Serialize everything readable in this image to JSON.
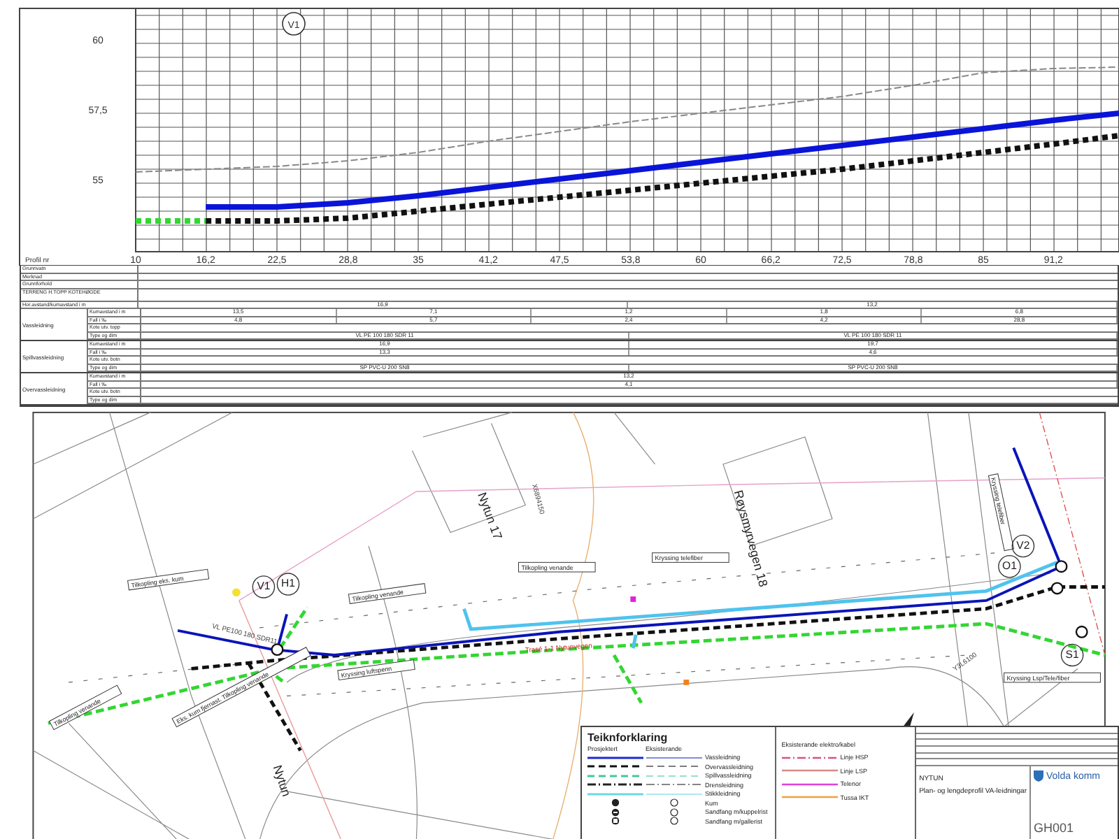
{
  "profile": {
    "row_label": "Profil nr",
    "marker": "V1",
    "chart_data": {
      "type": "line",
      "x": [
        10,
        16.2,
        22.5,
        28.8,
        35,
        41.2,
        47.5,
        53.8,
        60,
        66.2,
        72.5,
        78.8,
        85,
        91.2,
        97
      ],
      "series": [
        {
          "color": "#888888",
          "line_style": "dashed",
          "values": [
            55.4,
            55.5,
            55.6,
            55.8,
            56.1,
            56.5,
            56.85,
            57.2,
            57.5,
            57.8,
            58.1,
            58.5,
            58.95,
            59.1,
            59.15
          ]
        },
        {
          "color": "#0a14d8",
          "line_style": "solid",
          "values": [
            null,
            54.15,
            54.15,
            54.3,
            54.55,
            54.85,
            55.15,
            55.45,
            55.75,
            56.05,
            56.35,
            56.65,
            56.95,
            57.25,
            57.5
          ]
        },
        {
          "color": "#111111",
          "line_style": "dotted",
          "values": [
            null,
            53.65,
            53.65,
            53.75,
            54.0,
            54.25,
            54.5,
            54.75,
            55.0,
            55.25,
            55.5,
            55.8,
            56.1,
            56.4,
            56.7
          ]
        },
        {
          "color": "#33d633",
          "line_style": "dotted",
          "values": [
            53.65,
            53.65,
            null,
            null,
            null,
            null,
            null,
            null,
            null,
            null,
            null,
            null,
            null,
            null,
            null
          ]
        }
      ],
      "xlim": [
        10,
        97
      ],
      "grid": true,
      "xticks": [
        10,
        {
          "value": 16.2,
          "label": "16,2"
        },
        {
          "value": 22.5,
          "label": "22,5"
        },
        {
          "value": 28.8,
          "label": "28,8"
        },
        35,
        {
          "value": 41.2,
          "label": "41,2"
        },
        {
          "value": 47.5,
          "label": "47,5"
        },
        {
          "value": 53.8,
          "label": "53,8"
        },
        60,
        {
          "value": 66.2,
          "label": "66,2"
        },
        {
          "value": 72.5,
          "label": "72,5"
        },
        {
          "value": 78.8,
          "label": "78,8"
        },
        85,
        {
          "value": 91.2,
          "label": "91,2"
        }
      ],
      "yticks": [
        55,
        {
          "value": 57.5,
          "label": "57,5"
        },
        60
      ],
      "ylim": [
        52.55,
        61.25
      ]
    }
  },
  "table": {
    "rows": [
      {
        "label": "Grunnvatn"
      },
      {
        "label": "Merknad"
      },
      {
        "label": "Grunnforhold"
      },
      {
        "label": "TERRENG H.TOPP KOTEHØGDE"
      },
      {
        "label": "Hor.avstand/kumavstand i m",
        "cells": [
          "16,9",
          "13,2"
        ]
      }
    ],
    "groups": [
      {
        "name": "Vassleidning",
        "rows": [
          {
            "label": "Kumavstand i m",
            "cells": [
              "13,5",
              "7,1",
              "1,2",
              "1,8",
              "6,8"
            ]
          },
          {
            "label": "Fall i ‰",
            "cells": [
              "4,8",
              "5,7",
              "2,4",
              "4,2",
              "28,8"
            ]
          },
          {
            "label": "Kote utv. topp"
          },
          {
            "label": "Type og dim",
            "cells": [
              "VL PE 100 180 SDR 11",
              "VL PE 100 180 SDR 11"
            ]
          }
        ]
      },
      {
        "name": "Spillvassleidning",
        "rows": [
          {
            "label": "Kumavstand i m",
            "cells": [
              "16,9",
              "19,7"
            ]
          },
          {
            "label": "Fall i ‰",
            "cells": [
              "13,3",
              "4,6"
            ]
          },
          {
            "label": "Kote utv. botn"
          },
          {
            "label": "Type og dim",
            "cells": [
              "SP PVC-U 200 SN8",
              "SP PVC-U 200 SN8"
            ]
          }
        ]
      },
      {
        "name": "Overvassleidning",
        "rows": [
          {
            "label": "Kumavstand i m",
            "cells": [
              "13,2"
            ]
          },
          {
            "label": "Fall i ‰",
            "cells": [
              "4,1"
            ]
          },
          {
            "label": "Kote utv. botn"
          },
          {
            "label": "Type og dim"
          }
        ]
      }
    ]
  },
  "plan": {
    "labels": [
      {
        "kind": "building",
        "text": "Nytun 17"
      },
      {
        "kind": "street",
        "text": "Nytun"
      },
      {
        "kind": "building",
        "text": "Røysmyrvegen 18"
      },
      {
        "kind": "callout",
        "text": "Tilkopling eks. kum"
      },
      {
        "kind": "callout",
        "text": "Tilkopling venande"
      },
      {
        "kind": "callout",
        "text": "Kryssing luftspenn"
      },
      {
        "kind": "callout",
        "text": "Tilkopling venande"
      },
      {
        "kind": "callout",
        "text": "Eks. kum fjernast. Tilkopling venande"
      },
      {
        "kind": "callout",
        "text": "Kryssing telefiber"
      },
      {
        "kind": "callout",
        "text": "Tilkopling venande"
      },
      {
        "kind": "callout",
        "text": "Kryssing telefiber"
      },
      {
        "kind": "callout",
        "text": "Kryssing Lsp/Tele/fiber"
      },
      {
        "kind": "node",
        "text": "V1"
      },
      {
        "kind": "node",
        "text": "H1"
      },
      {
        "kind": "node",
        "text": "V2"
      },
      {
        "kind": "node",
        "text": "O1"
      },
      {
        "kind": "node",
        "text": "S1"
      },
      {
        "kind": "coordinate",
        "text": "X6894150"
      },
      {
        "kind": "coordinate",
        "text": "Y3L6100"
      },
      {
        "kind": "pipe",
        "text": "VL PE100 180 SDR11"
      },
      {
        "kind": "route",
        "text": "Trasé 1-1 Nytunvegen"
      }
    ]
  },
  "legend": {
    "title": "Teiknforklaring",
    "col_projected": "Prosjektert",
    "col_existing": "Eksisterande",
    "items": [
      {
        "kind": "line",
        "label": "Vassleidning",
        "color": "#1a2bd0"
      },
      {
        "kind": "dashed",
        "label": "Overvassleidning",
        "color": "#111111"
      },
      {
        "kind": "dashed",
        "label": "Spillvassleidning",
        "color": "#3fc9a0"
      },
      {
        "kind": "dashdot",
        "label": "Drensleidning",
        "color": "#222222"
      },
      {
        "kind": "line",
        "label": "Stikkleidning",
        "color": "#6cd6e6"
      },
      {
        "kind": "kum",
        "label": "Kum",
        "color": "#222222"
      },
      {
        "kind": "sandfang",
        "label": "Sandfang m/kuppelrist",
        "color": "#222222"
      },
      {
        "kind": "gallerist",
        "label": "Sandfang m/gallerist",
        "color": "#222222"
      }
    ],
    "cable_title": "Eksisterande elektro/kabel",
    "cables": [
      {
        "kind": "dashdot",
        "label": "Linje HSP",
        "color": "#e0507a"
      },
      {
        "kind": "line",
        "label": "Linje LSP",
        "color": "#d88a8a"
      },
      {
        "kind": "line",
        "label": "Telenor",
        "color": "#e040e0"
      },
      {
        "kind": "line",
        "label": "Tussa IKT",
        "color": "#f0a040"
      }
    ]
  },
  "title_block": {
    "place": "NYTUN",
    "title": "Plan- og lengdeprofil VA-leidningar",
    "owner": "Volda komm",
    "drawing_no": "GH001"
  }
}
